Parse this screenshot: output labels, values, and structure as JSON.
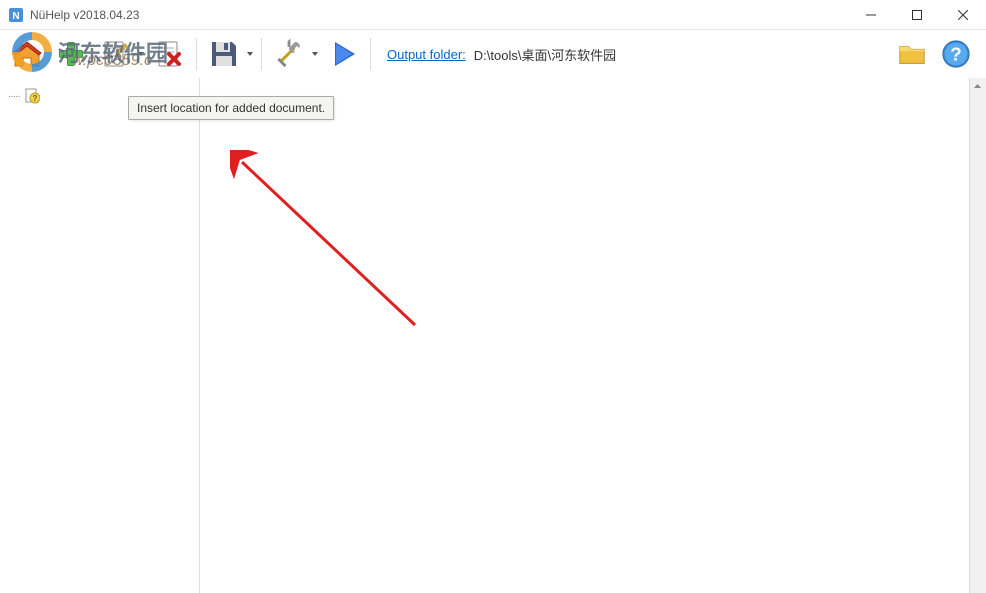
{
  "window": {
    "title": "NüHelp v2018.04.23"
  },
  "toolbar": {
    "output_folder_label": "Output folder:",
    "output_folder_path": "D:\\tools\\桌面\\河东软件园"
  },
  "tooltip": {
    "text": "Insert location for added document."
  },
  "watermark": {
    "site_name": "河东软件园",
    "site_url": "w.pc0359.c"
  },
  "icons": {
    "home": "home-icon",
    "add": "add-icon",
    "refresh": "refresh-icon",
    "remove": "remove-icon",
    "save": "save-icon",
    "tools": "tools-icon",
    "play": "play-icon",
    "folder": "folder-icon",
    "help": "help-icon"
  }
}
